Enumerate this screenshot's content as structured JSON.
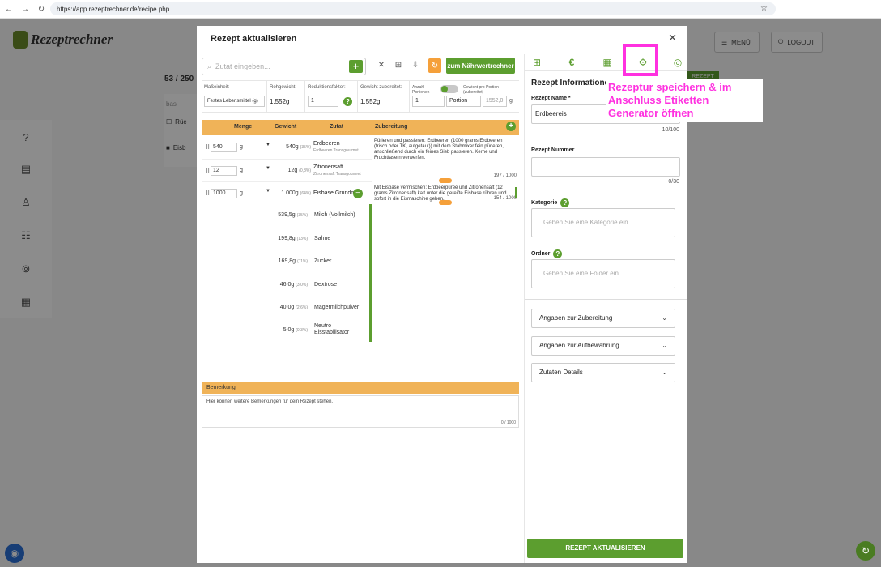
{
  "browser": {
    "url": "https://app.rezeptrechner.de/recipe.php"
  },
  "app": {
    "logo": "Rezeptrechner",
    "menu_label": "MENÜ",
    "logout_label": "LOGOUT",
    "count": "53 / 250",
    "bg_search": "bas",
    "bg_row1": "Rüc",
    "bg_row2": "Eisb",
    "bg_new": "REZEPT"
  },
  "modal": {
    "title": "Rezept aktualisieren",
    "search_placeholder": "Zutat eingeben...",
    "naehr_button": "zum Nährwertrechner",
    "params": {
      "masseinheit_label": "Maßeinheit:",
      "masseinheit_value": "Festes Lebensmittel (g)",
      "rohgewicht_label": "Rohgewicht:",
      "rohgewicht_value": "1.552g",
      "reduktion_label": "Reduktionsfaktor:",
      "reduktion_value": "1",
      "gewicht_label": "Gewicht zubereitet:",
      "gewicht_value": "1.552g",
      "portionen_label": "Anzahl Portionen",
      "portion_weight_label": "Gewicht pro Portion (zubereitet)",
      "portion_count": "1",
      "portion_unit": "Portion",
      "portion_weight": "1552,0",
      "portion_weight_unit": "g"
    },
    "table_headers": {
      "menge": "Menge",
      "gewicht": "Gewicht",
      "zutat": "Zutat",
      "zubereitung": "Zubereitung"
    },
    "ingredients": [
      {
        "qty": "540",
        "unit": "g",
        "weight": "540g",
        "pct": "(35%)",
        "name": "Erdbeeren",
        "sub": "Erdbeeren Transgourmet",
        "prep": "Pürieren und passieren: Erdbeeren (1000 grams Erdbeeren (frisch oder TK, aufgetaut)) mit dem Stabmixer fein pürieren, anschließend durch ein feines Sieb passieren. Kerne und Fruchtfasern verwerfen.",
        "prep_count": "197 / 1000"
      },
      {
        "qty": "12",
        "unit": "g",
        "weight": "12g",
        "pct": "(0,8%)",
        "name": "Zitronensaft",
        "sub": "Zitronensaft Transgourmet",
        "prep": "",
        "prep_count": ""
      },
      {
        "qty": "1000",
        "unit": "g",
        "weight": "1.000g",
        "pct": "(64%)",
        "name": "Eisbase Grundma",
        "sub": "",
        "prep": "Mit Eisbase vermischen: Erdbeerpüree und Zitronensaft (12 grams Zitronensaft) kalt unter die gereifte Eisbase rühren und sofort in die Eismaschine geben.",
        "prep_count": "154 / 1000"
      }
    ],
    "subingredients": [
      {
        "weight": "539,5g",
        "pct": "(35%)",
        "name": "Milch (Vollmilch)"
      },
      {
        "weight": "199,8g",
        "pct": "(13%)",
        "name": "Sahne"
      },
      {
        "weight": "169,8g",
        "pct": "(11%)",
        "name": "Zucker"
      },
      {
        "weight": "46,0g",
        "pct": "(3,0%)",
        "name": "Dextrose"
      },
      {
        "weight": "40,0g",
        "pct": "(2,6%)",
        "name": "Magermilchpulver"
      },
      {
        "weight": "5,0g",
        "pct": "(0,3%)",
        "name": "Neutro Eisstabilisator"
      }
    ],
    "bemerkung_label": "Bemerkung",
    "bemerkung_text": "Hier können weitere Bemerkungen für dein Rezept stehen.",
    "bemerkung_count": "0 / 1000",
    "right": {
      "heading": "Rezept Informationen",
      "name_label": "Rezept Name *",
      "name_value": "Erdbeereis",
      "name_count": "10/100",
      "nummer_label": "Rezept Nummer",
      "nummer_count": "0/30",
      "kategorie_label": "Kategorie",
      "kategorie_placeholder": "Geben Sie eine Kategorie ein",
      "ordner_label": "Ordner",
      "ordner_placeholder": "Geben Sie eine Folder ein",
      "acc1": "Angaben zur Zubereitung",
      "acc2": "Angaben zur Aufbewahrung",
      "acc3": "Zutaten Details",
      "update_button": "REZEPT AKTUALISIEREN"
    },
    "tooltip": "Rezeptur speichern & im Anschluss Etiketten Generator öffnen"
  },
  "colors": {
    "brand_green": "#5c9e2f",
    "orange": "#f0b358",
    "highlight": "#ff31e0"
  }
}
